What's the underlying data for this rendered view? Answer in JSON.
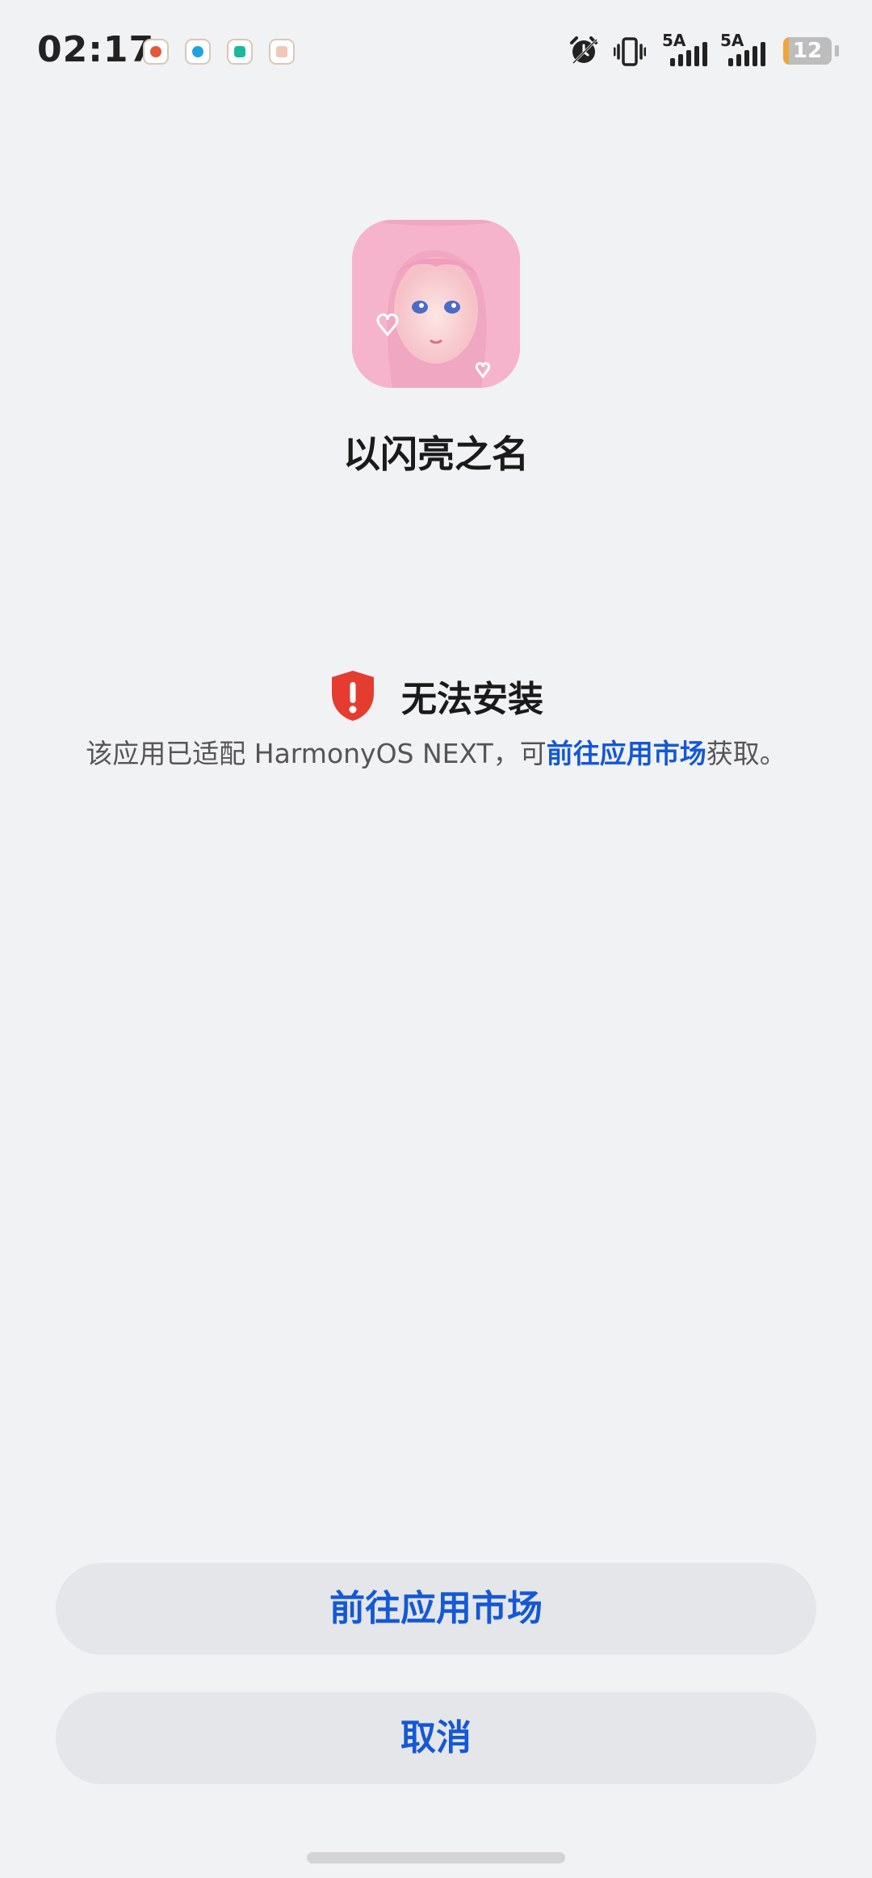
{
  "status_bar": {
    "time": "02:17",
    "notification_icons": [
      "notification-app-1-icon",
      "notification-app-2-icon",
      "notification-app-3-icon",
      "notification-app-4-icon"
    ],
    "network_1": "5A",
    "network_2": "5A",
    "battery_level": "12",
    "battery_fraction": 0.12
  },
  "app": {
    "name": "以闪亮之名",
    "icon": "app-icon-anime-girl"
  },
  "warning": {
    "title": "无法安装",
    "desc_prefix": "该应用已适配 HarmonyOS NEXT，可",
    "desc_link": "前往应用市场",
    "desc_suffix": "获取。",
    "icon": "shield-exclamation-icon",
    "icon_color": "#e43d30"
  },
  "buttons": {
    "go_market_label": "前往应用市场",
    "cancel_label": "取消"
  },
  "colors": {
    "accent": "#1458d6",
    "background": "#f1f2f4",
    "button_bg": "#e5e6e9"
  }
}
